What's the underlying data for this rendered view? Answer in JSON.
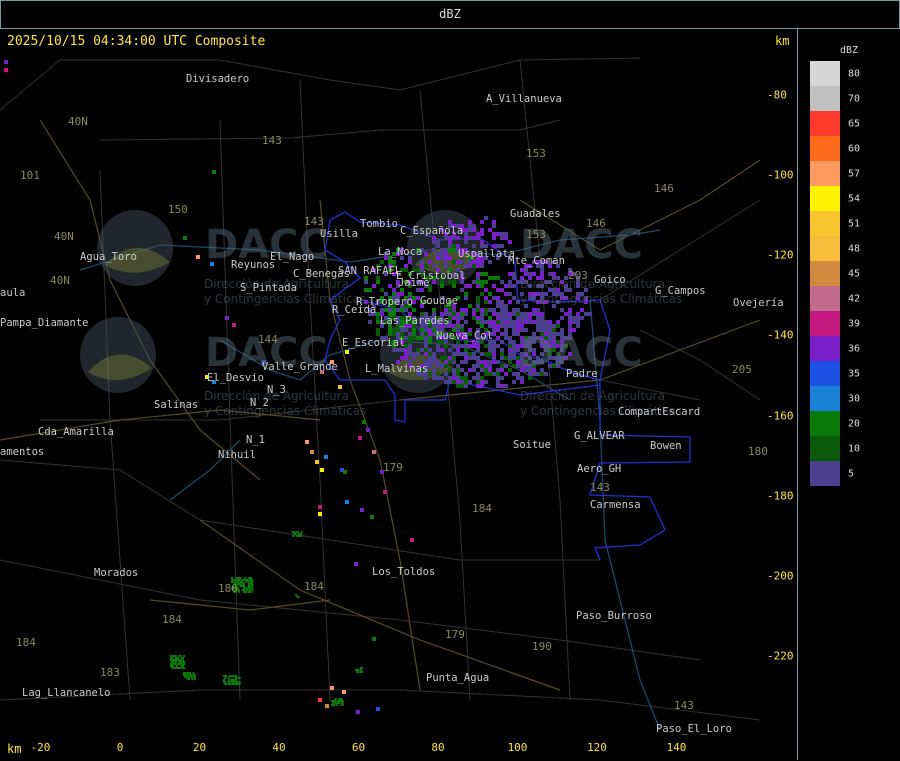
{
  "header": {
    "title": "dBZ"
  },
  "map": {
    "timestamp": "2025/10/15 04:34:00 UTC Composite",
    "km_top": "km",
    "km_bottom": "km",
    "x_ticks": [
      "-20",
      "0",
      "20",
      "40",
      "60",
      "80",
      "100",
      "120",
      "140"
    ],
    "y_ticks": [
      "-80",
      "-100",
      "-120",
      "-140",
      "-160",
      "-180",
      "-200",
      "-220"
    ],
    "watermark": {
      "logo": "DACC",
      "line1": "Dirección de Agricultura",
      "line2": "y Contingencias Climáticas"
    },
    "places": [
      {
        "name": "Divisadero",
        "x": 186,
        "y": 80
      },
      {
        "name": "A_Villanueva",
        "x": 486,
        "y": 100
      },
      {
        "name": "Guadales",
        "x": 510,
        "y": 215
      },
      {
        "name": "Tombio",
        "x": 360,
        "y": 225
      },
      {
        "name": "C_Española",
        "x": 400,
        "y": 232
      },
      {
        "name": "Usilla",
        "x": 320,
        "y": 235
      },
      {
        "name": "Uspallata",
        "x": 458,
        "y": 255
      },
      {
        "name": "La_Noca",
        "x": 378,
        "y": 253
      },
      {
        "name": "Agua_Toro",
        "x": 80,
        "y": 258
      },
      {
        "name": "Reyunos",
        "x": 231,
        "y": 266
      },
      {
        "name": "El_Nago",
        "x": 270,
        "y": 258
      },
      {
        "name": "Mte_Coman",
        "x": 508,
        "y": 262
      },
      {
        "name": "Goico",
        "x": 594,
        "y": 281
      },
      {
        "name": "G_Campos",
        "x": 655,
        "y": 292
      },
      {
        "name": "C_Benegas",
        "x": 293,
        "y": 275
      },
      {
        "name": "SAN RAFAEL",
        "x": 338,
        "y": 272
      },
      {
        "name": "E_Cristobal",
        "x": 396,
        "y": 277
      },
      {
        "name": "Jaime",
        "x": 398,
        "y": 284
      },
      {
        "name": "S_Pintada",
        "x": 240,
        "y": 289
      },
      {
        "name": "Pampa_Diamante",
        "x": 0,
        "y": 324
      },
      {
        "name": "aula",
        "x": 0,
        "y": 294
      },
      {
        "name": "R_Tropero",
        "x": 356,
        "y": 303
      },
      {
        "name": "Goudge",
        "x": 420,
        "y": 302
      },
      {
        "name": "R_Ceida",
        "x": 332,
        "y": 311
      },
      {
        "name": "Las_Paredes",
        "x": 380,
        "y": 322
      },
      {
        "name": "Nueva_Col",
        "x": 436,
        "y": 337
      },
      {
        "name": "Ovejería",
        "x": 733,
        "y": 304
      },
      {
        "name": "E_Escorial",
        "x": 342,
        "y": 344
      },
      {
        "name": "Valle_Grande",
        "x": 262,
        "y": 368
      },
      {
        "name": "L_Malvinas",
        "x": 365,
        "y": 370
      },
      {
        "name": "Padre",
        "x": 566,
        "y": 375
      },
      {
        "name": "El_Desvio",
        "x": 207,
        "y": 379
      },
      {
        "name": "N_3",
        "x": 267,
        "y": 391
      },
      {
        "name": "N_2",
        "x": 250,
        "y": 404
      },
      {
        "name": "Salinas",
        "x": 154,
        "y": 406
      },
      {
        "name": "CompartEscard",
        "x": 618,
        "y": 413
      },
      {
        "name": "Cda_Amarilla",
        "x": 38,
        "y": 433
      },
      {
        "name": "G_ALVEAR",
        "x": 574,
        "y": 437
      },
      {
        "name": "N_1",
        "x": 246,
        "y": 441
      },
      {
        "name": "Soitue",
        "x": 513,
        "y": 446
      },
      {
        "name": "Bowen",
        "x": 650,
        "y": 447
      },
      {
        "name": "amentos",
        "x": 0,
        "y": 453
      },
      {
        "name": "Nihuil",
        "x": 218,
        "y": 456
      },
      {
        "name": "Aero_GH",
        "x": 577,
        "y": 470
      },
      {
        "name": "Carmensa",
        "x": 590,
        "y": 506
      },
      {
        "name": "Los_Toldos",
        "x": 372,
        "y": 573
      },
      {
        "name": "Morados",
        "x": 94,
        "y": 574
      },
      {
        "name": "Paso_Burroso",
        "x": 576,
        "y": 617
      },
      {
        "name": "Punta_Agua",
        "x": 426,
        "y": 679
      },
      {
        "name": "Lag_Llancanelo",
        "x": 22,
        "y": 694
      },
      {
        "name": "Paso_El_Loro",
        "x": 656,
        "y": 730
      }
    ],
    "roads": [
      {
        "name": "143",
        "x": 262,
        "y": 141
      },
      {
        "name": "153",
        "x": 526,
        "y": 154
      },
      {
        "name": "146",
        "x": 654,
        "y": 189
      },
      {
        "name": "150",
        "x": 168,
        "y": 210
      },
      {
        "name": "143",
        "x": 304,
        "y": 222
      },
      {
        "name": "146",
        "x": 586,
        "y": 224
      },
      {
        "name": "40N",
        "x": 68,
        "y": 122
      },
      {
        "name": "101",
        "x": 20,
        "y": 176
      },
      {
        "name": "40N",
        "x": 54,
        "y": 237
      },
      {
        "name": "40N",
        "x": 50,
        "y": 281
      },
      {
        "name": "153",
        "x": 526,
        "y": 235
      },
      {
        "name": "203",
        "x": 568,
        "y": 276
      },
      {
        "name": "144",
        "x": 258,
        "y": 340
      },
      {
        "name": "205",
        "x": 732,
        "y": 370
      },
      {
        "name": "180",
        "x": 748,
        "y": 452
      },
      {
        "name": "179",
        "x": 383,
        "y": 468
      },
      {
        "name": "184",
        "x": 472,
        "y": 509
      },
      {
        "name": "143",
        "x": 590,
        "y": 488
      },
      {
        "name": "186",
        "x": 218,
        "y": 589
      },
      {
        "name": "184",
        "x": 304,
        "y": 587
      },
      {
        "name": "184",
        "x": 162,
        "y": 620
      },
      {
        "name": "179",
        "x": 445,
        "y": 635
      },
      {
        "name": "190",
        "x": 532,
        "y": 647
      },
      {
        "name": "184",
        "x": 16,
        "y": 643
      },
      {
        "name": "183",
        "x": 100,
        "y": 673
      },
      {
        "name": "143",
        "x": 674,
        "y": 706
      }
    ]
  },
  "legend": {
    "title": "dBZ",
    "entries": [
      {
        "label": "80",
        "color": "#d7d7d7"
      },
      {
        "label": "70",
        "color": "#c0c0c0"
      },
      {
        "label": "65",
        "color": "#ff3a2a"
      },
      {
        "label": "60",
        "color": "#ff6a1a"
      },
      {
        "label": "57",
        "color": "#ff9a60"
      },
      {
        "label": "54",
        "color": "#fff200"
      },
      {
        "label": "51",
        "color": "#f9c52e"
      },
      {
        "label": "48",
        "color": "#f7bc3a"
      },
      {
        "label": "45",
        "color": "#d18a3e"
      },
      {
        "label": "42",
        "color": "#c26a8c"
      },
      {
        "label": "39",
        "color": "#c3187f"
      },
      {
        "label": "36",
        "color": "#7a1ec8"
      },
      {
        "label": "35",
        "color": "#1e50e6"
      },
      {
        "label": "30",
        "color": "#1a82d7"
      },
      {
        "label": "20",
        "color": "#0a7a0a"
      },
      {
        "label": "10",
        "color": "#0a5a0a"
      },
      {
        "label": "5",
        "color": "#4c3f8f"
      }
    ]
  }
}
